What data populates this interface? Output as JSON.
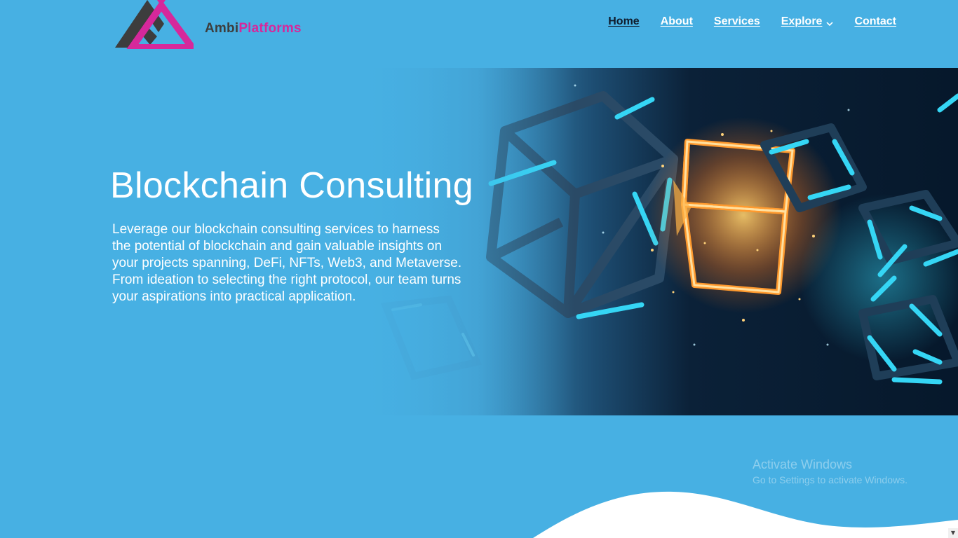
{
  "brand": {
    "name_part1": "Ambi",
    "name_part2": "Platforms",
    "colors": {
      "dark": "#3d3d3d",
      "accent": "#d6289b"
    }
  },
  "nav": {
    "items": [
      {
        "label": "Home",
        "active": true
      },
      {
        "label": "About"
      },
      {
        "label": "Services"
      },
      {
        "label": "Explore",
        "has_dropdown": true
      },
      {
        "label": "Contact"
      }
    ]
  },
  "hero": {
    "title": "Blockchain Consulting",
    "lines": [
      "Leverage our blockchain consulting services to harness",
      "the potential of blockchain and gain valuable insights on",
      "your projects spanning, DeFi, NFTs, Web3, and Metaverse.",
      "From ideation to selecting the right protocol, our team turns",
      "your aspirations into practical application."
    ]
  },
  "watermark": {
    "title": "Activate Windows",
    "subtitle": "Go to Settings to activate Windows."
  },
  "colors": {
    "background": "#47b0e3",
    "hero_dark": "#06182b",
    "glow_cyan": "#35d6f5",
    "glow_orange": "#ff9a2e",
    "wave": "#ffffff"
  },
  "icons": {
    "dropdown": "chevron-down-icon",
    "scroll": "scroll-down-arrow-icon"
  }
}
